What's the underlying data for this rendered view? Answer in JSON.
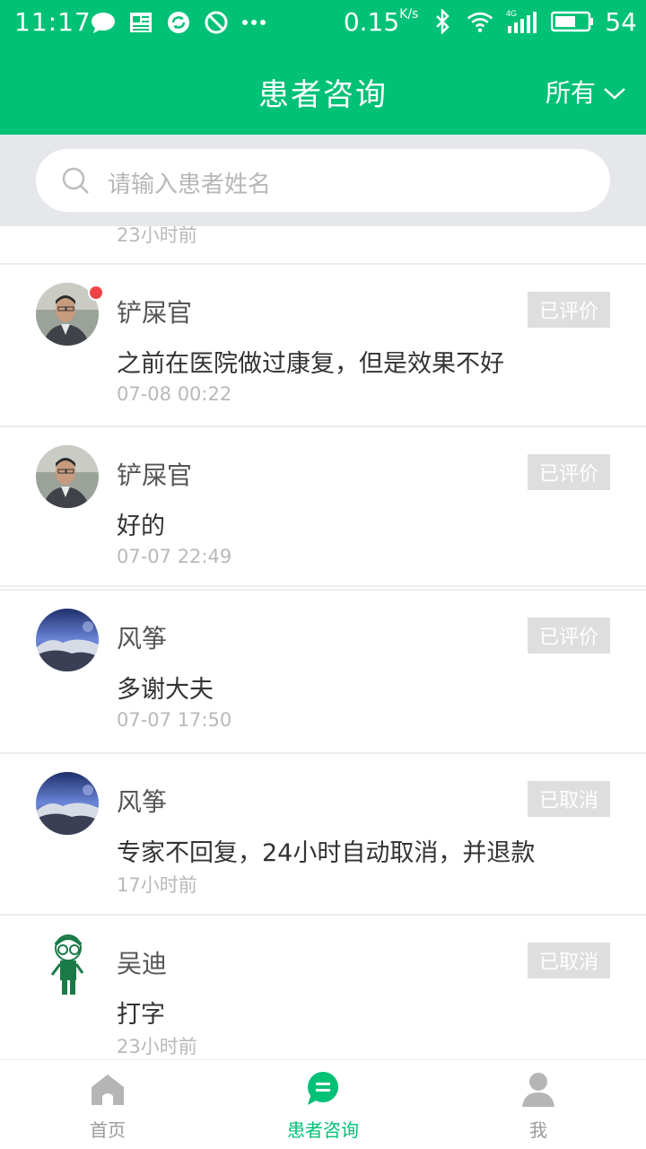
{
  "status_bar": {
    "time": "11:17",
    "speed_value": "0.15",
    "speed_unit": "K/s",
    "network": "4G",
    "battery": "54",
    "icons": [
      "message-icon",
      "news-icon",
      "sync-icon",
      "block-icon",
      "more-icon",
      "bluetooth-icon",
      "wifi-icon",
      "signal-icon",
      "battery-icon"
    ]
  },
  "header": {
    "title": "患者咨询",
    "filter_label": "所有"
  },
  "search": {
    "placeholder": "请输入患者姓名"
  },
  "list": {
    "partial_time": "23小时前",
    "items": [
      {
        "name": "铲屎官",
        "message": "之前在医院做过康复，但是效果不好",
        "time": "07-08 00:22",
        "status": "已评价",
        "unread": true,
        "avatar": "person-photo"
      },
      {
        "name": "铲屎官",
        "message": "好的",
        "time": "07-07 22:49",
        "status": "已评价",
        "unread": false,
        "avatar": "person-photo"
      },
      {
        "name": "风筝",
        "message": "多谢大夫",
        "time": "07-07 17:50",
        "status": "已评价",
        "unread": false,
        "avatar": "landscape-photo"
      },
      {
        "name": "风筝",
        "message": "专家不回复，24小时自动取消，并退款",
        "time": "17小时前",
        "status": "已取消",
        "unread": false,
        "avatar": "landscape-photo"
      },
      {
        "name": "吴迪",
        "message": "打字",
        "time": "23小时前",
        "status": "已取消",
        "unread": false,
        "avatar": "cartoon-figure"
      }
    ]
  },
  "bottom_nav": {
    "tabs": [
      {
        "label": "首页",
        "icon": "home-icon",
        "active": false
      },
      {
        "label": "患者咨询",
        "icon": "chat-icon",
        "active": true
      },
      {
        "label": "我",
        "icon": "user-icon",
        "active": false
      }
    ]
  },
  "colors": {
    "brand_green": "#00c176",
    "badge_gray": "#dedede",
    "unread_red": "#f04347"
  }
}
